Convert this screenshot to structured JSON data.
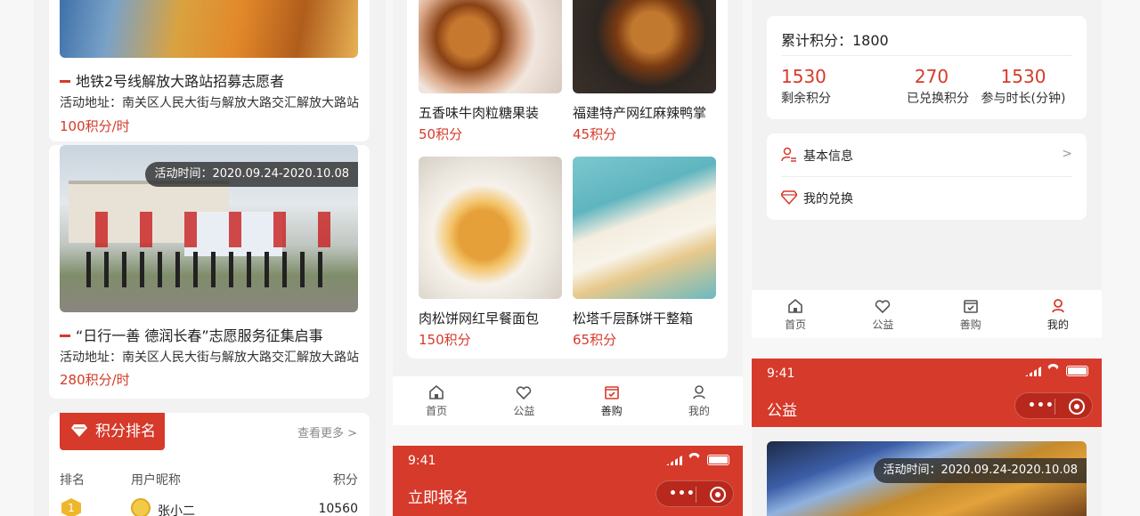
{
  "left": {
    "event1": {
      "title": "地铁2号线解放大路站招募志愿者",
      "address": "活动地址：南关区人民大街与解放大路交汇解放大路站",
      "points": "100积分/时"
    },
    "event2": {
      "time_badge": "活动时间：2020.09.24-2020.10.08",
      "title": "“日行一善 德润长春”志愿服务征集启事",
      "address": "活动地址：南关区人民大街与解放大路交汇解放大路站",
      "points": "280积分/时"
    },
    "ranking": {
      "title": "积分排名",
      "more": "查看更多 >",
      "headers": [
        "排名",
        "用户昵称",
        "积分"
      ],
      "rows": [
        {
          "rank": "1",
          "name": "张小二",
          "score": "10560"
        }
      ]
    }
  },
  "middle": {
    "products": [
      {
        "name": "五香味牛肉粒糖果装",
        "points": "50积分"
      },
      {
        "name": "福建特产网红麻辣鸭掌",
        "points": "45积分"
      },
      {
        "name": "肉松饼网红早餐面包",
        "points": "150积分"
      },
      {
        "name": "松塔千层酥饼干整箱",
        "points": "65积分"
      }
    ],
    "tabbar": {
      "home": "首页",
      "charity": "公益",
      "shop": "善购",
      "mine": "我的"
    },
    "screen2": {
      "time": "9:41",
      "title": "立即报名",
      "dots": "•••"
    }
  },
  "right": {
    "stats": {
      "total_label": "累计积分：1800",
      "items": [
        {
          "value": "1530",
          "label": "剩余积分"
        },
        {
          "value": "270",
          "label": "已兑换积分"
        },
        {
          "value": "1530",
          "label": "参与时长(分钟)"
        }
      ]
    },
    "menu": {
      "basic": "基本信息",
      "basic_arrow": ">",
      "exchange": "我的兑换"
    },
    "tabbar": {
      "home": "首页",
      "charity": "公益",
      "shop": "善购",
      "mine": "我的"
    },
    "screen2": {
      "time": "9:41",
      "title": "公益",
      "dots": "•••",
      "time_badge": "活动时间：2020.09.24-2020.10.08"
    }
  },
  "colors": {
    "accent": "#d63a2a",
    "background": "#f2f2f2"
  }
}
